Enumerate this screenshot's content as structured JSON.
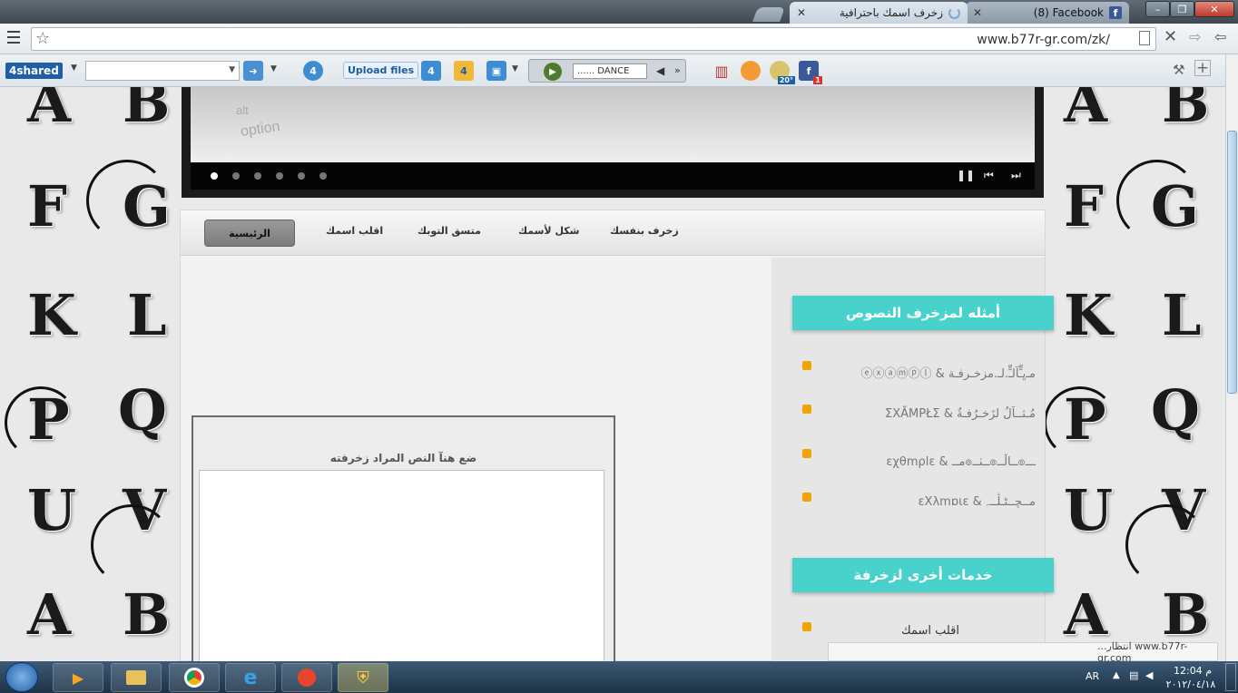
{
  "browser": {
    "tabs": [
      {
        "title": "زخرف اسمك باحترافية",
        "active": true
      },
      {
        "title": "(8) Facebook",
        "active": false
      }
    ],
    "url": "www.b77r-gr.com/zk/",
    "window_controls": {
      "minimize": "–",
      "maximize": "❐",
      "close": "✕"
    }
  },
  "toolbar": {
    "brand": "4shared",
    "upload_label": "Upload files",
    "radio_label": "...... DANCE",
    "weather_temp": "20°",
    "facebook_badge": "1"
  },
  "nav": {
    "items": [
      "زخرف بنفسك",
      "شكل لأسمك",
      "متسق التوبك",
      "اقلب اسمك",
      "الرئيسية"
    ],
    "active": "الرئيسية"
  },
  "main": {
    "input_label": "ضع هنآ النص المراد زخرفته"
  },
  "sidebar": {
    "examples_title": "أمثله لمزخرف النصوص",
    "examples": [
      "ⓔⓧⓐⓜⓟⓛ & مـﭜـٍّﺂلـٍّ.لـ.ﻣﺰخـرفـة",
      "ΣXĂMPŁΣ & مُـثــاَلُ لزَخـرُفـةٌ",
      "εχθmρlε & ﻣــ๏ــٺــ๏ــاڵــ๏ـــ",
      "εXλmɒιε & ﻣــﭽــﭩـڷــﮧ"
    ],
    "services_title": "خدمات أخرى لزخرفة",
    "services": [
      "اقلب اسمك"
    ]
  },
  "slider": {
    "dots": 6,
    "active_dot": 1
  },
  "status_bar": {
    "text": "...انتظار www.b77r-gr.com"
  },
  "taskbar": {
    "language": "AR",
    "time": "12:04 م",
    "date": "٢٠١٢/٠٤/١٨"
  },
  "background_letters": [
    "A",
    "B",
    "F",
    "G",
    "K",
    "L",
    "P",
    "Q",
    "U",
    "V"
  ],
  "colors": {
    "accent": "#49d1cc",
    "bullet": "#f0a400"
  }
}
